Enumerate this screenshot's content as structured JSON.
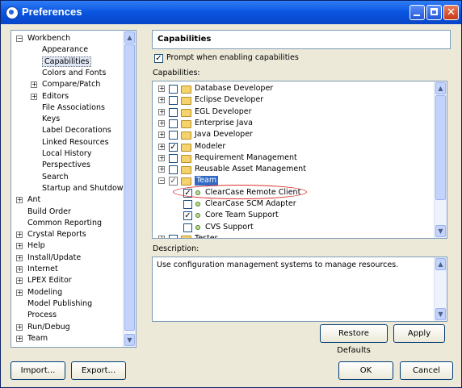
{
  "window": {
    "title": "Preferences",
    "colors": {
      "title_bar": "#0a55e0",
      "selection": "#dfe7f5",
      "annotation": "#d83030"
    }
  },
  "tree": {
    "items": [
      {
        "label": "Workbench",
        "expander": "−"
      },
      {
        "label": "Appearance"
      },
      {
        "label": "Capabilities",
        "selected": true
      },
      {
        "label": "Colors and Fonts"
      },
      {
        "label": "Compare/Patch",
        "expander": "+"
      },
      {
        "label": "Editors",
        "expander": "+"
      },
      {
        "label": "File Associations"
      },
      {
        "label": "Keys"
      },
      {
        "label": "Label Decorations"
      },
      {
        "label": "Linked Resources"
      },
      {
        "label": "Local History"
      },
      {
        "label": "Perspectives"
      },
      {
        "label": "Search"
      },
      {
        "label": "Startup and Shutdown"
      },
      {
        "label": "Ant",
        "expander": "+"
      },
      {
        "label": "Build Order"
      },
      {
        "label": "Common Reporting"
      },
      {
        "label": "Crystal Reports",
        "expander": "+"
      },
      {
        "label": "Help",
        "expander": "+"
      },
      {
        "label": "Install/Update",
        "expander": "+"
      },
      {
        "label": "Internet",
        "expander": "+"
      },
      {
        "label": "LPEX Editor",
        "expander": "+"
      },
      {
        "label": "Modeling",
        "expander": "+"
      },
      {
        "label": "Model Publishing"
      },
      {
        "label": "Process"
      },
      {
        "label": "Run/Debug",
        "expander": "+"
      },
      {
        "label": "Team",
        "expander": "+"
      }
    ]
  },
  "page": {
    "title": "Capabilities",
    "prompt_label": "Prompt when enabling capabilities",
    "capabilities_label": "Capabilities:",
    "description_label": "Description:",
    "description_text": "Use configuration management systems to manage resources.",
    "capabilities": [
      {
        "label": "Database Developer",
        "checked": false,
        "expander": "+"
      },
      {
        "label": "Eclipse Developer",
        "checked": false,
        "expander": "+"
      },
      {
        "label": "EGL Developer",
        "checked": false,
        "expander": "+"
      },
      {
        "label": "Enterprise Java",
        "checked": false,
        "expander": "+"
      },
      {
        "label": "Java Developer",
        "checked": false,
        "expander": "+"
      },
      {
        "label": "Modeler",
        "checked": true,
        "expander": "+"
      },
      {
        "label": "Requirement Management",
        "checked": false,
        "expander": "+"
      },
      {
        "label": "Reusable Asset Management",
        "checked": false,
        "expander": "+"
      },
      {
        "label": "Team",
        "checked": true,
        "grayed": true,
        "expander": "−",
        "selected": true
      },
      {
        "label": "ClearCase Remote Client",
        "checked": true,
        "child": true
      },
      {
        "label": "ClearCase SCM Adapter",
        "checked": false,
        "child": true
      },
      {
        "label": "Core Team Support",
        "checked": true,
        "child": true
      },
      {
        "label": "CVS Support",
        "checked": false,
        "child": true
      },
      {
        "label": "Tester",
        "checked": false,
        "expander": "+"
      }
    ]
  },
  "buttons": {
    "restore_defaults": "Restore Defaults",
    "apply": "Apply",
    "import": "Import...",
    "export": "Export...",
    "ok": "OK",
    "cancel": "Cancel"
  }
}
